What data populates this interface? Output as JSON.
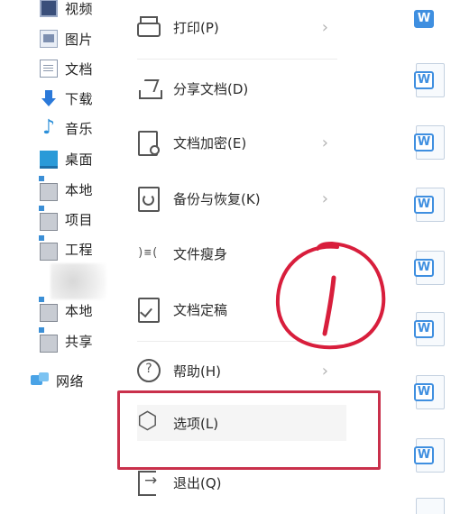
{
  "explorer": {
    "items": [
      {
        "label": "视频",
        "icon": "video-icon"
      },
      {
        "label": "图片",
        "icon": "pictures-icon"
      },
      {
        "label": "文档",
        "icon": "documents-icon"
      },
      {
        "label": "下载",
        "icon": "download-icon"
      },
      {
        "label": "音乐",
        "icon": "music-icon"
      },
      {
        "label": "桌面",
        "icon": "desktop-icon"
      },
      {
        "label": "本地",
        "icon": "drive-icon"
      },
      {
        "label": "项目",
        "icon": "drive-icon"
      },
      {
        "label": "工程",
        "icon": "drive-icon"
      },
      {
        "label": "本地",
        "icon": "drive-icon"
      },
      {
        "label": "共享",
        "icon": "drive-icon"
      }
    ],
    "network": {
      "label": "网络",
      "icon": "network-icon"
    }
  },
  "menu": {
    "items": [
      {
        "label": "打印(P)",
        "icon": "printer-icon",
        "has_submenu": true
      },
      {
        "label": "分享文档(D)",
        "icon": "share-icon",
        "has_submenu": false
      },
      {
        "label": "文档加密(E)",
        "icon": "lock-document-icon",
        "has_submenu": true
      },
      {
        "label": "备份与恢复(K)",
        "icon": "backup-icon",
        "has_submenu": true
      },
      {
        "label": "文件瘦身",
        "icon": "slim-file-icon",
        "has_submenu": false
      },
      {
        "label": "文档定稿",
        "icon": "finalize-icon",
        "has_submenu": false
      },
      {
        "label": "帮助(H)",
        "icon": "help-icon",
        "has_submenu": true
      },
      {
        "label": "选项(L)",
        "icon": "options-icon",
        "has_submenu": false,
        "highlighted": true
      },
      {
        "label": "退出(Q)",
        "icon": "exit-icon",
        "has_submenu": false
      }
    ],
    "submenu_chevron": "›"
  },
  "files": {
    "badge_letter": "W",
    "count": 10
  },
  "colors": {
    "highlight": "#c9304b",
    "annotation": "#d81e3c",
    "wps_blue": "#3f8fe0"
  }
}
